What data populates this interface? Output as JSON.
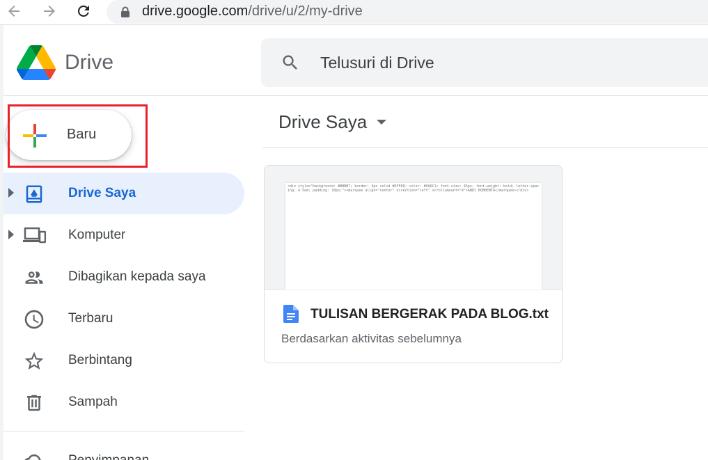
{
  "browser": {
    "url_host": "drive.google.com",
    "url_path": "/drive/u/2/my-drive",
    "icons": [
      "back-arrow-icon",
      "forward-arrow-icon",
      "reload-icon",
      "lock-icon"
    ]
  },
  "header": {
    "brand": "Drive",
    "search_placeholder": "Telusuri di Drive"
  },
  "new_button": {
    "label": "Baru"
  },
  "sidebar": {
    "items": [
      {
        "label": "Drive Saya",
        "icon": "my-drive-icon",
        "active": true,
        "expandable": true
      },
      {
        "label": "Komputer",
        "icon": "computer-icon",
        "active": false,
        "expandable": true
      },
      {
        "label": "Dibagikan kepada saya",
        "icon": "shared-people-icon",
        "active": false,
        "expandable": false
      },
      {
        "label": "Terbaru",
        "icon": "clock-icon",
        "active": false,
        "expandable": false
      },
      {
        "label": "Berbintang",
        "icon": "star-icon",
        "active": false,
        "expandable": false
      },
      {
        "label": "Sampah",
        "icon": "trash-icon",
        "active": false,
        "expandable": false
      },
      {
        "label": "Penyimpanan",
        "icon": "cloud-icon",
        "active": false,
        "expandable": false
      }
    ]
  },
  "main": {
    "title": "Drive Saya",
    "file": {
      "name": "TULISAN BERGERAK PADA BLOG.txt",
      "subtitle": "Berdasarkan aktivitas sebelumnya",
      "preview": "<div style=\"background: #BBBB7; border: 3px solid #DFF0D; color: #9A6C1; font-size: 45px; font-weight: bold; letter-spacing: 4.5em; padding: 10px;\"><marquee align=\"center\" direction=\"left\" scrollamount=\"4\">ANDI BOBBENTA</marquee></div>"
    }
  },
  "colors": {
    "accent": "#1967d2",
    "active_bg": "#e8f0fe",
    "highlight_border": "#e8212b",
    "google_blue": "#4285f4",
    "google_red": "#ea4335",
    "google_yellow": "#fbbc04",
    "google_green": "#34a853"
  }
}
